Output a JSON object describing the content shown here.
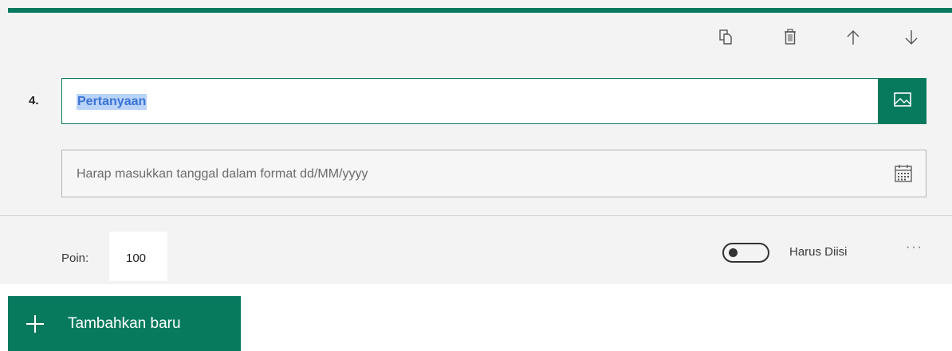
{
  "question": {
    "number": "4.",
    "title_value": "Pertanyaan",
    "date_placeholder": "Harap masukkan tanggal dalam format dd/MM/yyyy"
  },
  "toolbar": {
    "icons": [
      "copy-icon",
      "delete-icon",
      "arrow-up-icon",
      "arrow-down-icon"
    ]
  },
  "footer": {
    "points_label": "Poin:",
    "points_value": "100",
    "required_label": "Harus Diisi",
    "required_on": false,
    "more_label": "···"
  },
  "add_button": {
    "label": "Tambahkan baru"
  },
  "colors": {
    "accent": "#077a5e",
    "selection": "#b9d3f9",
    "card_bg": "#f3f3f3"
  }
}
